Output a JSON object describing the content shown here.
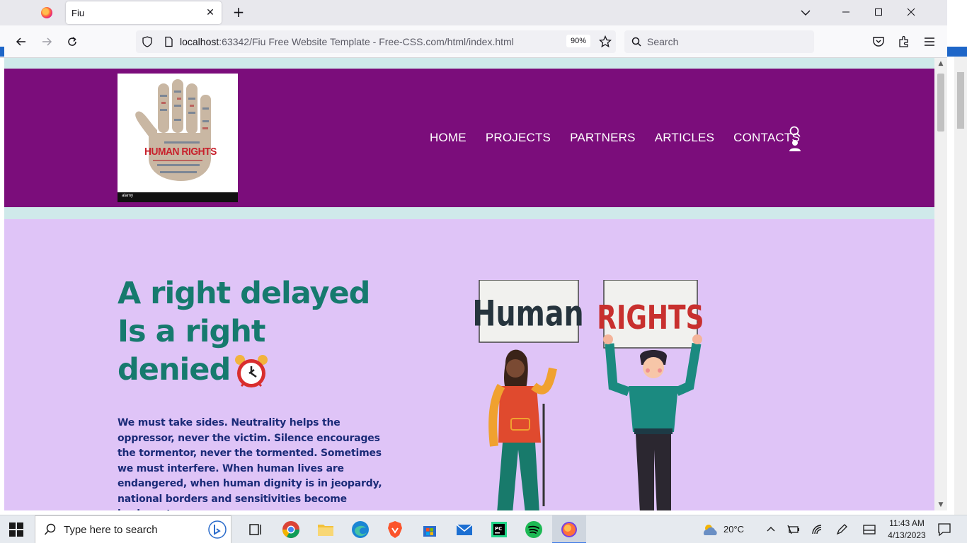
{
  "browser": {
    "tab_title": "Fiu",
    "url_host": "localhost",
    "url_rest": ":63342/Fiu Free Website Template - Free-CSS.com/html/index.html",
    "zoom": "90%",
    "search_placeholder": "Search"
  },
  "site": {
    "logo": {
      "caption": "HUMAN RIGHTS",
      "watermark": "alamy"
    },
    "nav": [
      "HOME",
      "PROJECTS",
      "PARTNERS",
      "ARTICLES",
      "CONTACTS"
    ],
    "colors": {
      "header": "#7b0d7b",
      "hero_bg": "#dfc4f7",
      "title": "#167a6e",
      "body_text": "#1b2b78"
    }
  },
  "hero": {
    "title_line1": "A right delayed",
    "title_line2": "Is a right",
    "title_line3": "denied",
    "title_emoji": "alarm-clock-icon",
    "body": "We must take sides. Neutrality helps the oppressor, never the victim. Silence encourages the tormentor, never the tormented. Sometimes we must interfere. When human lives are endangered, when human dignity is in jeopardy, national borders and sensitivities become irrelevant.",
    "sign_left": "Human",
    "sign_right": "RIGHTS"
  },
  "taskbar": {
    "search_placeholder": "Type here to search",
    "weather": "20°C",
    "time": "11:43 AM",
    "date": "4/13/2023"
  }
}
